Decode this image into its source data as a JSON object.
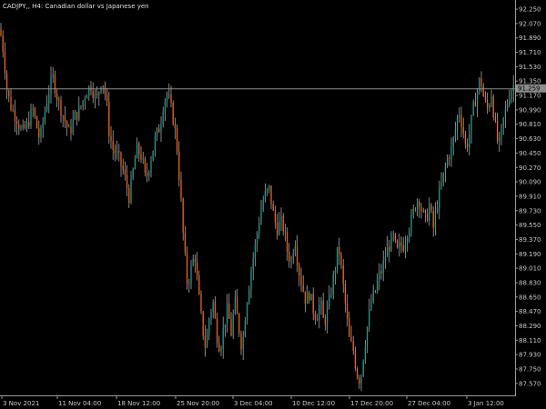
{
  "window": {
    "title": "CADJPY,, H4:  Canadian dollar vs Japanese yen"
  },
  "price_scale": {
    "labels": [
      "92.250",
      "92.070",
      "91.890",
      "91.710",
      "91.530",
      "91.350",
      "91.170",
      "90.990",
      "90.810",
      "90.630",
      "90.450",
      "90.270",
      "90.090",
      "89.910",
      "89.730",
      "89.550",
      "89.370",
      "89.190",
      "89.010",
      "88.830",
      "88.650",
      "88.470",
      "88.290",
      "88.110",
      "87.930",
      "87.750",
      "87.570"
    ],
    "current_price_label": "91.259"
  },
  "time_scale": {
    "labels": [
      "3 Nov 2021",
      "11 Nov 04:00",
      "18 Nov 12:00",
      "25 Nov 20:00",
      "3 Dec 04:00",
      "10 Dec 12:00",
      "17 Dec 20:00",
      "27 Dec 04:00",
      "3 Jan 12:00"
    ]
  },
  "colors": {
    "background": "#000000",
    "bull": "#26a69a",
    "bear": "#ff6a1a",
    "wick": "#bdbdbd",
    "current_price_line": "#8c8c8c",
    "axis": "#9a9a9a",
    "text": "#c8c8c8"
  },
  "chart_data": {
    "type": "candlestick",
    "symbol": "CADJPY",
    "timeframe": "H4",
    "ylim": [
      87.5,
      92.33
    ],
    "current_price": 91.259,
    "close_path": [
      [
        0,
        92.0
      ],
      [
        4,
        91.7
      ],
      [
        8,
        91.2
      ],
      [
        13,
        91.0
      ],
      [
        18,
        90.9
      ],
      [
        24,
        90.7
      ],
      [
        30,
        90.8
      ],
      [
        36,
        91.0
      ],
      [
        40,
        90.8
      ],
      [
        44,
        90.6
      ],
      [
        48,
        90.9
      ],
      [
        53,
        91.2
      ],
      [
        58,
        91.4
      ],
      [
        64,
        91.1
      ],
      [
        70,
        90.9
      ],
      [
        76,
        90.7
      ],
      [
        82,
        90.9
      ],
      [
        88,
        91.0
      ],
      [
        94,
        91.2
      ],
      [
        100,
        91.3
      ],
      [
        106,
        91.1
      ],
      [
        112,
        91.4
      ],
      [
        117,
        91.1
      ],
      [
        120,
        90.7
      ],
      [
        124,
        90.5
      ],
      [
        130,
        90.4
      ],
      [
        136,
        90.2
      ],
      [
        142,
        89.9
      ],
      [
        146,
        90.2
      ],
      [
        150,
        90.5
      ],
      [
        156,
        90.4
      ],
      [
        160,
        90.1
      ],
      [
        164,
        90.3
      ],
      [
        170,
        90.6
      ],
      [
        176,
        90.8
      ],
      [
        180,
        91.1
      ],
      [
        184,
        91.2
      ],
      [
        190,
        90.9
      ],
      [
        194,
        90.6
      ],
      [
        198,
        90.0
      ],
      [
        202,
        89.3
      ],
      [
        206,
        88.8
      ],
      [
        210,
        89.0
      ],
      [
        214,
        89.2
      ],
      [
        218,
        88.7
      ],
      [
        222,
        88.3
      ],
      [
        226,
        88.0
      ],
      [
        230,
        88.4
      ],
      [
        234,
        88.6
      ],
      [
        238,
        88.2
      ],
      [
        242,
        88.0
      ],
      [
        246,
        88.3
      ],
      [
        250,
        88.5
      ],
      [
        254,
        88.2
      ],
      [
        258,
        88.6
      ],
      [
        262,
        88.3
      ],
      [
        266,
        88.0
      ],
      [
        270,
        88.5
      ],
      [
        276,
        89.0
      ],
      [
        282,
        89.4
      ],
      [
        286,
        89.7
      ],
      [
        290,
        89.9
      ],
      [
        296,
        90.0
      ],
      [
        300,
        89.7
      ],
      [
        304,
        89.5
      ],
      [
        308,
        89.6
      ],
      [
        312,
        89.5
      ],
      [
        316,
        89.2
      ],
      [
        320,
        89.1
      ],
      [
        324,
        89.4
      ],
      [
        328,
        89.0
      ],
      [
        332,
        88.8
      ],
      [
        336,
        88.6
      ],
      [
        340,
        88.7
      ],
      [
        344,
        88.5
      ],
      [
        348,
        88.4
      ],
      [
        352,
        88.6
      ],
      [
        356,
        88.3
      ],
      [
        362,
        88.6
      ],
      [
        368,
        89.0
      ],
      [
        372,
        89.3
      ],
      [
        376,
        88.9
      ],
      [
        380,
        88.5
      ],
      [
        384,
        88.1
      ],
      [
        388,
        88.0
      ],
      [
        392,
        87.7
      ],
      [
        396,
        87.6
      ],
      [
        400,
        88.0
      ],
      [
        404,
        88.3
      ],
      [
        408,
        88.6
      ],
      [
        412,
        88.7
      ],
      [
        416,
        88.9
      ],
      [
        420,
        89.0
      ],
      [
        424,
        89.2
      ],
      [
        428,
        89.3
      ],
      [
        432,
        89.4
      ],
      [
        436,
        89.2
      ],
      [
        440,
        89.3
      ],
      [
        444,
        89.3
      ],
      [
        448,
        89.5
      ],
      [
        452,
        89.6
      ],
      [
        456,
        89.8
      ],
      [
        460,
        89.9
      ],
      [
        464,
        89.7
      ],
      [
        468,
        89.6
      ],
      [
        472,
        89.8
      ],
      [
        476,
        89.5
      ],
      [
        480,
        89.8
      ],
      [
        484,
        90.0
      ],
      [
        488,
        90.2
      ],
      [
        492,
        90.4
      ],
      [
        496,
        90.5
      ],
      [
        500,
        90.7
      ],
      [
        504,
        91.0
      ],
      [
        508,
        90.8
      ],
      [
        512,
        90.5
      ],
      [
        516,
        90.7
      ],
      [
        520,
        91.0
      ],
      [
        524,
        91.2
      ],
      [
        528,
        91.4
      ],
      [
        532,
        91.1
      ],
      [
        536,
        91.0
      ],
      [
        540,
        91.2
      ],
      [
        544,
        90.8
      ],
      [
        548,
        90.5
      ],
      [
        552,
        90.8
      ],
      [
        556,
        91.0
      ],
      [
        560,
        91.2
      ],
      [
        564,
        91.3
      ],
      [
        568,
        91.2
      ]
    ]
  }
}
